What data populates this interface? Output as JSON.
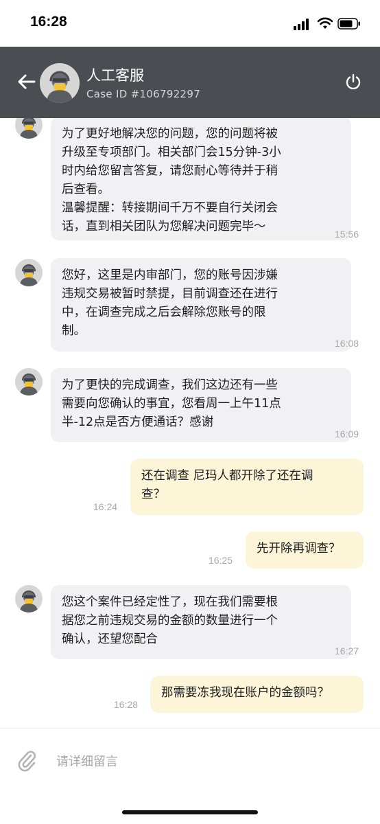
{
  "status_bar": {
    "time": "16:28"
  },
  "header": {
    "title": "人工客服",
    "case_id": "Case ID #106792297",
    "back_icon": "arrow-left-icon",
    "power_icon": "power-icon"
  },
  "messages": [
    {
      "side": "agent",
      "lines": [
        "为了更好地解决您的问题，您的问题将被",
        "升级至专项部门。相关部门会15分钟-3小",
        "时内给您留言答复，请您耐心等待并于稍",
        "后查看。",
        "温馨提醒：转接期间千万不要自行关闭会",
        "话，直到相关团队为您解决问题完毕～"
      ],
      "time": "15:56"
    },
    {
      "side": "agent",
      "lines": [
        "您好，这里是内审部门，您的账号因涉嫌",
        "违规交易被暂时禁提，目前调查还在进行",
        "中，在调查完成之后会解除您账号的限",
        "制。"
      ],
      "time": "16:08"
    },
    {
      "side": "agent",
      "lines": [
        "为了更快的完成调查，我们这边还有一些",
        "需要向您确认的事宜，您看周一上午11点",
        "半-12点是否方便通话？感谢"
      ],
      "time": "16:09"
    },
    {
      "side": "user",
      "lines": [
        "还在调查 尼玛人都开除了还在调",
        "查？"
      ],
      "time": "16:24"
    },
    {
      "side": "user",
      "lines": [
        "先开除再调查？"
      ],
      "time": "16:25"
    },
    {
      "side": "agent",
      "lines": [
        "您这个案件已经定性了，现在我们需要根",
        "据您之前违规交易的金额的数量进行一个",
        "确认，还望您配合"
      ],
      "time": "16:27"
    },
    {
      "side": "user",
      "lines": [
        "那需要冻我现在账户的金额吗？"
      ],
      "time": "16:28"
    }
  ],
  "input": {
    "placeholder": "请详细留言",
    "attach_icon": "paperclip-icon"
  },
  "colors": {
    "header_bg": "#4a4d52",
    "agent_bubble": "#f1f1f3",
    "user_bubble": "#fcf5d8",
    "timestamp": "#a8a8a8"
  }
}
